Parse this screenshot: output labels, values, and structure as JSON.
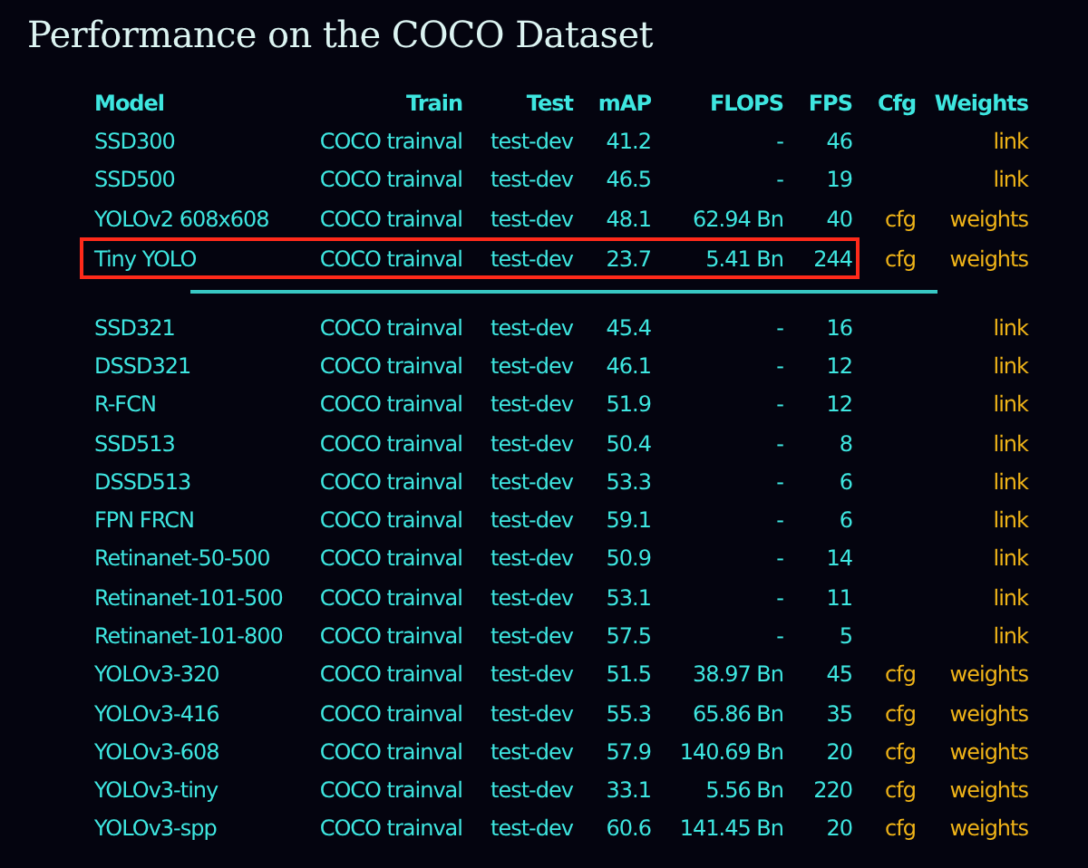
{
  "title": "Performance on the COCO Dataset",
  "table": {
    "columns": [
      "Model",
      "Train",
      "Test",
      "mAP",
      "FLOPS",
      "FPS",
      "Cfg",
      "Weights"
    ],
    "groups": [
      {
        "rows": [
          {
            "model": "SSD300",
            "train": "COCO trainval",
            "test": "test-dev",
            "map": "41.2",
            "flops": "-",
            "fps": "46",
            "weights": "link",
            "highlighted": false
          },
          {
            "model": "SSD500",
            "train": "COCO trainval",
            "test": "test-dev",
            "map": "46.5",
            "flops": "-",
            "fps": "19",
            "weights": "link",
            "highlighted": false
          },
          {
            "model": "YOLOv2 608x608",
            "train": "COCO trainval",
            "test": "test-dev",
            "map": "48.1",
            "flops": "62.94 Bn",
            "fps": "40",
            "cfg": "cfg",
            "weights": "weights",
            "highlighted": false
          },
          {
            "model": "Tiny YOLO",
            "train": "COCO trainval",
            "test": "test-dev",
            "map": "23.7",
            "flops": "5.41 Bn",
            "fps": "244",
            "cfg": "cfg",
            "weights": "weights",
            "highlighted": true
          }
        ]
      },
      {
        "rows": [
          {
            "model": "SSD321",
            "train": "COCO trainval",
            "test": "test-dev",
            "map": "45.4",
            "flops": "-",
            "fps": "16",
            "weights": "link",
            "highlighted": false
          },
          {
            "model": "DSSD321",
            "train": "COCO trainval",
            "test": "test-dev",
            "map": "46.1",
            "flops": "-",
            "fps": "12",
            "weights": "link",
            "highlighted": false
          },
          {
            "model": "R-FCN",
            "train": "COCO trainval",
            "test": "test-dev",
            "map": "51.9",
            "flops": "-",
            "fps": "12",
            "weights": "link",
            "highlighted": false
          },
          {
            "model": "SSD513",
            "train": "COCO trainval",
            "test": "test-dev",
            "map": "50.4",
            "flops": "-",
            "fps": "8",
            "weights": "link",
            "highlighted": false
          },
          {
            "model": "DSSD513",
            "train": "COCO trainval",
            "test": "test-dev",
            "map": "53.3",
            "flops": "-",
            "fps": "6",
            "weights": "link",
            "highlighted": false
          },
          {
            "model": "FPN FRCN",
            "train": "COCO trainval",
            "test": "test-dev",
            "map": "59.1",
            "flops": "-",
            "fps": "6",
            "weights": "link",
            "highlighted": false
          },
          {
            "model": "Retinanet-50-500",
            "train": "COCO trainval",
            "test": "test-dev",
            "map": "50.9",
            "flops": "-",
            "fps": "14",
            "weights": "link",
            "highlighted": false
          },
          {
            "model": "Retinanet-101-500",
            "train": "COCO trainval",
            "test": "test-dev",
            "map": "53.1",
            "flops": "-",
            "fps": "11",
            "weights": "link",
            "highlighted": false
          },
          {
            "model": "Retinanet-101-800",
            "train": "COCO trainval",
            "test": "test-dev",
            "map": "57.5",
            "flops": "-",
            "fps": "5",
            "weights": "link",
            "highlighted": false
          },
          {
            "model": "YOLOv3-320",
            "train": "COCO trainval",
            "test": "test-dev",
            "map": "51.5",
            "flops": "38.97 Bn",
            "fps": "45",
            "cfg": "cfg",
            "weights": "weights",
            "highlighted": false
          },
          {
            "model": "YOLOv3-416",
            "train": "COCO trainval",
            "test": "test-dev",
            "map": "55.3",
            "flops": "65.86 Bn",
            "fps": "35",
            "cfg": "cfg",
            "weights": "weights",
            "highlighted": false
          },
          {
            "model": "YOLOv3-608",
            "train": "COCO trainval",
            "test": "test-dev",
            "map": "57.9",
            "flops": "140.69 Bn",
            "fps": "20",
            "cfg": "cfg",
            "weights": "weights",
            "highlighted": false
          },
          {
            "model": "YOLOv3-tiny",
            "train": "COCO trainval",
            "test": "test-dev",
            "map": "33.1",
            "flops": "5.56 Bn",
            "fps": "220",
            "cfg": "cfg",
            "weights": "weights",
            "highlighted": false
          },
          {
            "model": "YOLOv3-spp",
            "train": "COCO trainval",
            "test": "test-dev",
            "map": "60.6",
            "flops": "141.45 Bn",
            "fps": "20",
            "cfg": "cfg",
            "weights": "weights",
            "highlighted": false
          }
        ]
      }
    ]
  }
}
